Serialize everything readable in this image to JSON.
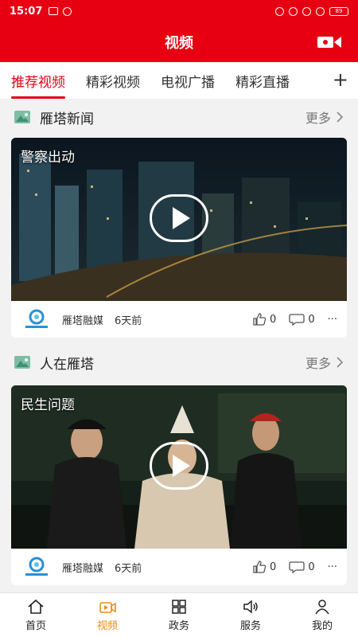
{
  "status": {
    "time": "15:07",
    "battery": "89"
  },
  "header": {
    "title": "视频"
  },
  "tabs": [
    {
      "label": "推荐视频",
      "active": true
    },
    {
      "label": "精彩视频",
      "active": false
    },
    {
      "label": "电视广播",
      "active": false
    },
    {
      "label": "精彩直播",
      "active": false
    }
  ],
  "tab_add": "+",
  "sections": [
    {
      "title": "雁塔新闻",
      "more": "更多",
      "video_caption": "警察出动",
      "source": "雁塔融媒",
      "time_ago": "6天前",
      "likes": "0",
      "comments": "0",
      "more_actions": "···"
    },
    {
      "title": "人在雁塔",
      "more": "更多",
      "video_caption": "民生问题",
      "source": "雁塔融媒",
      "time_ago": "6天前",
      "likes": "0",
      "comments": "0",
      "more_actions": "···"
    }
  ],
  "nav": [
    {
      "label": "首页",
      "icon": "home-icon",
      "active": false
    },
    {
      "label": "视频",
      "icon": "video-icon",
      "active": true
    },
    {
      "label": "政务",
      "icon": "grid-icon",
      "active": false
    },
    {
      "label": "服务",
      "icon": "speaker-icon",
      "active": false
    },
    {
      "label": "我的",
      "icon": "person-icon",
      "active": false
    }
  ],
  "colors": {
    "brand_red": "#e60012",
    "nav_active": "#f08a1c"
  }
}
